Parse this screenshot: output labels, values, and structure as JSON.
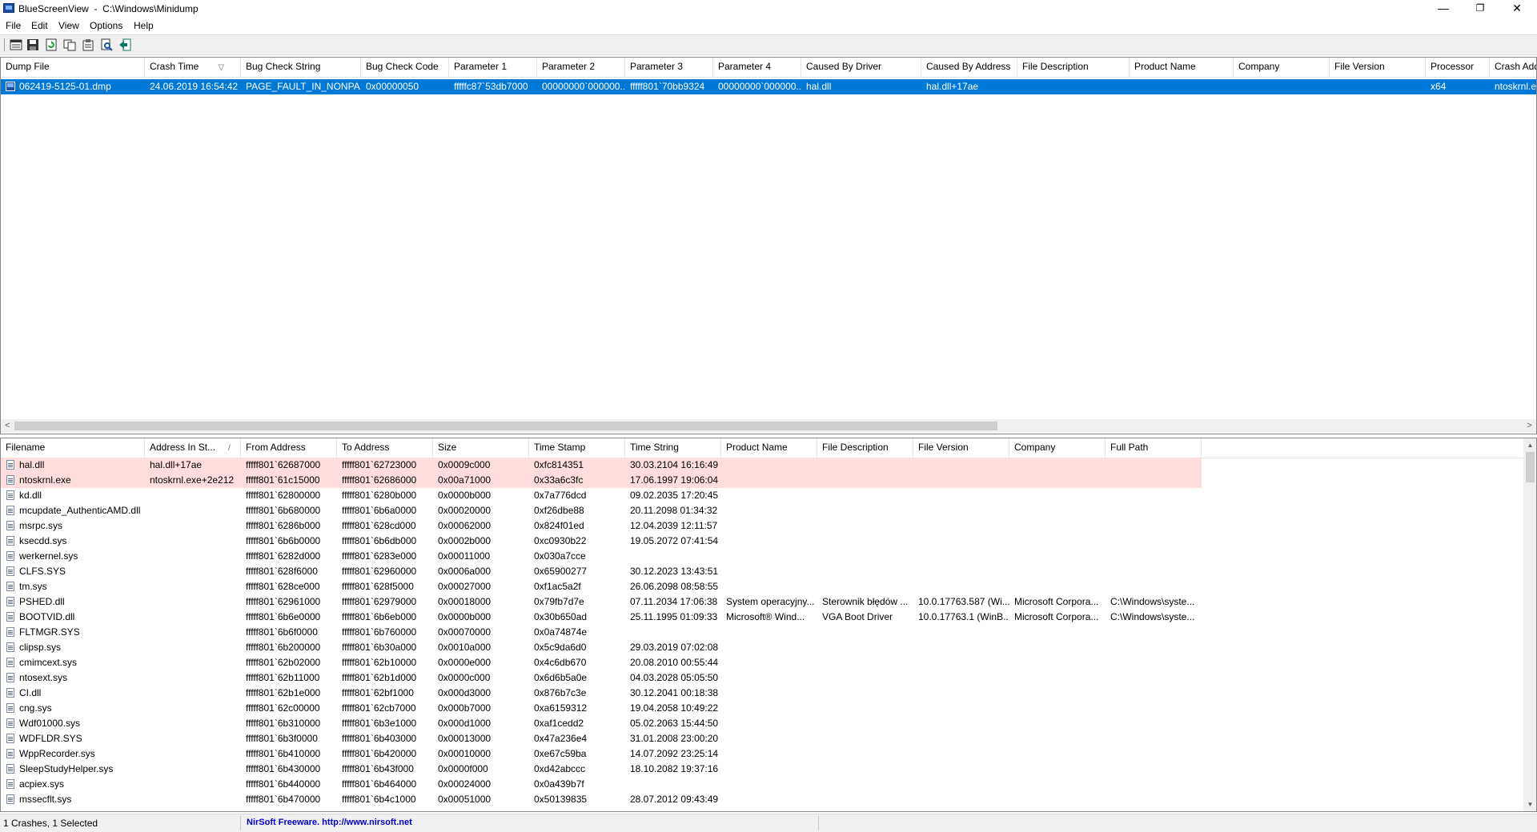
{
  "window": {
    "title": "BlueScreenView  -  C:\\Windows\\Minidump",
    "minimize": "—",
    "restore": "❐",
    "close": "✕"
  },
  "menu": [
    {
      "label": "File"
    },
    {
      "label": "Edit"
    },
    {
      "label": "View"
    },
    {
      "label": "Options"
    },
    {
      "label": "Help"
    }
  ],
  "toolbar": [
    {
      "name": "html-report-icon"
    },
    {
      "name": "save-icon"
    },
    {
      "name": "refresh-icon"
    },
    {
      "name": "copy-icon"
    },
    {
      "name": "properties-icon"
    },
    {
      "name": "find-icon"
    },
    {
      "name": "exit-icon"
    }
  ],
  "upper": {
    "columns": [
      "Dump File",
      "Crash Time",
      "Bug Check String",
      "Bug Check Code",
      "Parameter 1",
      "Parameter 2",
      "Parameter 3",
      "Parameter 4",
      "Caused By Driver",
      "Caused By Address",
      "File Description",
      "Product Name",
      "Company",
      "File Version",
      "Processor",
      "Crash Add"
    ],
    "sort_arrow": "▽",
    "rows": [
      [
        "062419-5125-01.dmp",
        "24.06.2019 16:54:42",
        "PAGE_FAULT_IN_NONPA...",
        "0x00000050",
        "fffffc87`53db7000",
        "00000000`000000...",
        "fffff801`70bb9324",
        "00000000`000000...",
        "hal.dll",
        "hal.dll+17ae",
        "",
        "",
        "",
        "",
        "x64",
        "ntoskrnl.e"
      ]
    ],
    "scroll_left": "<",
    "scroll_right": ">"
  },
  "lower": {
    "columns": [
      "Filename",
      "Address In St...",
      "From Address",
      "To Address",
      "Size",
      "Time Stamp",
      "Time String",
      "Product Name",
      "File Description",
      "File Version",
      "Company",
      "Full Path"
    ],
    "sort_arrow": "/",
    "rows": [
      [
        "hal.dll",
        "hal.dll+17ae",
        "fffff801`62687000",
        "fffff801`62723000",
        "0x0009c000",
        "0xfc814351",
        "30.03.2104 16:16:49",
        "",
        "",
        "",
        "",
        ""
      ],
      [
        "ntoskrnl.exe",
        "ntoskrnl.exe+2e212",
        "fffff801`61c15000",
        "fffff801`62686000",
        "0x00a71000",
        "0x33a6c3fc",
        "17.06.1997 19:06:04",
        "",
        "",
        "",
        "",
        ""
      ],
      [
        "kd.dll",
        "",
        "fffff801`62800000",
        "fffff801`6280b000",
        "0x0000b000",
        "0x7a776dcd",
        "09.02.2035 17:20:45",
        "",
        "",
        "",
        "",
        ""
      ],
      [
        "mcupdate_AuthenticAMD.dll",
        "",
        "fffff801`6b680000",
        "fffff801`6b6a0000",
        "0x00020000",
        "0xf26dbe88",
        "20.11.2098 01:34:32",
        "",
        "",
        "",
        "",
        ""
      ],
      [
        "msrpc.sys",
        "",
        "fffff801`6286b000",
        "fffff801`628cd000",
        "0x00062000",
        "0x824f01ed",
        "12.04.2039 12:11:57",
        "",
        "",
        "",
        "",
        ""
      ],
      [
        "ksecdd.sys",
        "",
        "fffff801`6b6b0000",
        "fffff801`6b6db000",
        "0x0002b000",
        "0xc0930b22",
        "19.05.2072 07:41:54",
        "",
        "",
        "",
        "",
        ""
      ],
      [
        "werkernel.sys",
        "",
        "fffff801`6282d000",
        "fffff801`6283e000",
        "0x00011000",
        "0x030a7cce",
        "",
        "",
        "",
        "",
        "",
        ""
      ],
      [
        "CLFS.SYS",
        "",
        "fffff801`628f6000",
        "fffff801`62960000",
        "0x0006a000",
        "0x65900277",
        "30.12.2023 13:43:51",
        "",
        "",
        "",
        "",
        ""
      ],
      [
        "tm.sys",
        "",
        "fffff801`628ce000",
        "fffff801`628f5000",
        "0x00027000",
        "0xf1ac5a2f",
        "26.06.2098 08:58:55",
        "",
        "",
        "",
        "",
        ""
      ],
      [
        "PSHED.dll",
        "",
        "fffff801`62961000",
        "fffff801`62979000",
        "0x00018000",
        "0x79fb7d7e",
        "07.11.2034 17:06:38",
        "System operacyjny...",
        "Sterownik błędów ...",
        "10.0.17763.587 (Wi...",
        "Microsoft Corpora...",
        "C:\\Windows\\syste..."
      ],
      [
        "BOOTVID.dll",
        "",
        "fffff801`6b6e0000",
        "fffff801`6b6eb000",
        "0x0000b000",
        "0x30b650ad",
        "25.11.1995 01:09:33",
        "Microsoft® Wind...",
        "VGA Boot Driver",
        "10.0.17763.1 (WinB...",
        "Microsoft Corpora...",
        "C:\\Windows\\syste..."
      ],
      [
        "FLTMGR.SYS",
        "",
        "fffff801`6b6f0000",
        "fffff801`6b760000",
        "0x00070000",
        "0x0a74874e",
        "",
        "",
        "",
        "",
        "",
        ""
      ],
      [
        "clipsp.sys",
        "",
        "fffff801`6b200000",
        "fffff801`6b30a000",
        "0x0010a000",
        "0x5c9da6d0",
        "29.03.2019 07:02:08",
        "",
        "",
        "",
        "",
        ""
      ],
      [
        "cmimcext.sys",
        "",
        "fffff801`62b02000",
        "fffff801`62b10000",
        "0x0000e000",
        "0x4c6db670",
        "20.08.2010 00:55:44",
        "",
        "",
        "",
        "",
        ""
      ],
      [
        "ntosext.sys",
        "",
        "fffff801`62b11000",
        "fffff801`62b1d000",
        "0x0000c000",
        "0x6d6b5a0e",
        "04.03.2028 05:05:50",
        "",
        "",
        "",
        "",
        ""
      ],
      [
        "CI.dll",
        "",
        "fffff801`62b1e000",
        "fffff801`62bf1000",
        "0x000d3000",
        "0x876b7c3e",
        "30.12.2041 00:18:38",
        "",
        "",
        "",
        "",
        ""
      ],
      [
        "cng.sys",
        "",
        "fffff801`62c00000",
        "fffff801`62cb7000",
        "0x000b7000",
        "0xa6159312",
        "19.04.2058 10:49:22",
        "",
        "",
        "",
        "",
        ""
      ],
      [
        "Wdf01000.sys",
        "",
        "fffff801`6b310000",
        "fffff801`6b3e1000",
        "0x000d1000",
        "0xaf1cedd2",
        "05.02.2063 15:44:50",
        "",
        "",
        "",
        "",
        ""
      ],
      [
        "WDFLDR.SYS",
        "",
        "fffff801`6b3f0000",
        "fffff801`6b403000",
        "0x00013000",
        "0x47a236e4",
        "31.01.2008 23:00:20",
        "",
        "",
        "",
        "",
        ""
      ],
      [
        "WppRecorder.sys",
        "",
        "fffff801`6b410000",
        "fffff801`6b420000",
        "0x00010000",
        "0xe67c59ba",
        "14.07.2092 23:25:14",
        "",
        "",
        "",
        "",
        ""
      ],
      [
        "SleepStudyHelper.sys",
        "",
        "fffff801`6b430000",
        "fffff801`6b43f000",
        "0x0000f000",
        "0xd42abccc",
        "18.10.2082 19:37:16",
        "",
        "",
        "",
        "",
        ""
      ],
      [
        "acpiex.sys",
        "",
        "fffff801`6b440000",
        "fffff801`6b464000",
        "0x00024000",
        "0x0a439b7f",
        "",
        "",
        "",
        "",
        "",
        ""
      ],
      [
        "mssecflt.sys",
        "",
        "fffff801`6b470000",
        "fffff801`6b4c1000",
        "0x00051000",
        "0x50139835",
        "28.07.2012 09:43:49",
        "",
        "",
        "",
        "",
        ""
      ]
    ],
    "scroll_up": "▲",
    "scroll_down": "▼"
  },
  "status": {
    "crashes": "1 Crashes, 1 Selected",
    "nirsoft": "NirSoft Freeware.  http://www.nirsoft.net"
  },
  "colors": {
    "selection": "#0078d7",
    "highlight_row": "#ffdddd",
    "link": "#0000cc"
  }
}
